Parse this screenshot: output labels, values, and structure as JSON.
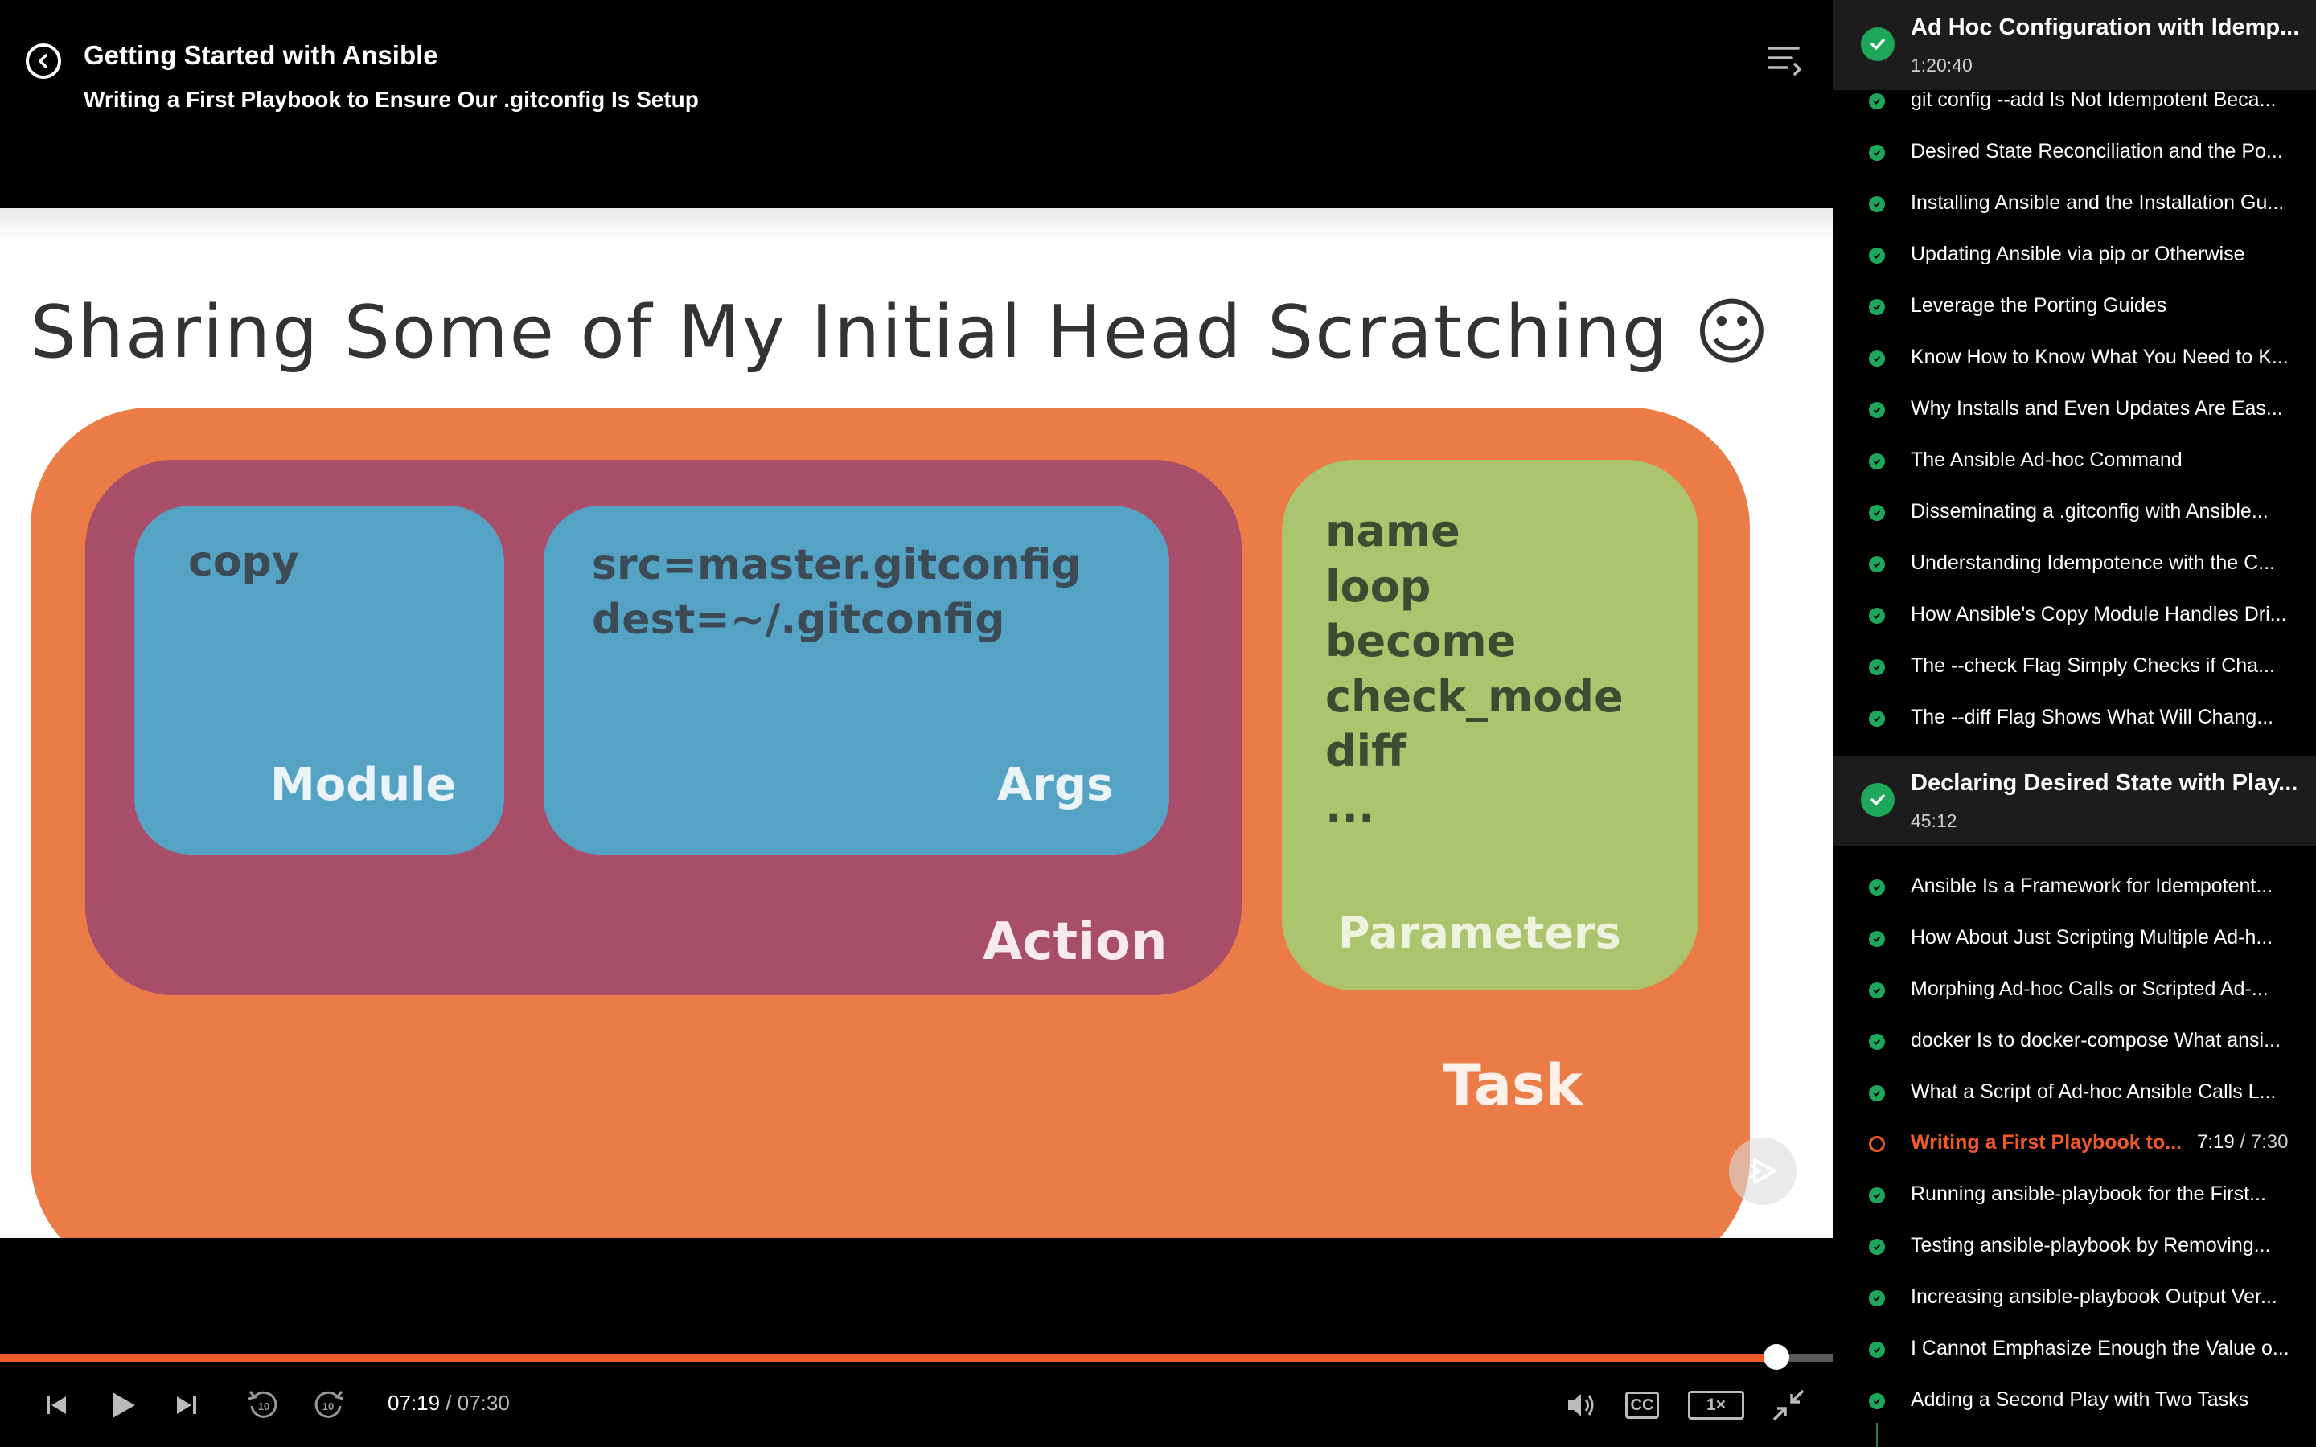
{
  "header": {
    "course_title": "Getting Started with Ansible",
    "clip_title": "Writing a First Playbook to Ensure Our .gitconfig Is Setup"
  },
  "slide": {
    "title": "Sharing Some of My Initial Head Scratching ☺",
    "module_content": "copy",
    "module_label": "Module",
    "args_content": "src=master.gitconfig\ndest=~/.gitconfig",
    "args_label": "Args",
    "action_label": "Action",
    "params_content": "name\nloop\nbecome\ncheck_mode\ndiff\n...",
    "params_label": "Parameters",
    "task_label": "Task"
  },
  "controls": {
    "time_current": "07:19",
    "time_separator": " / ",
    "time_total": "07:30",
    "progress_fraction": 0.9689,
    "cc_label": "CC",
    "speed_label": "1×",
    "accent_color": "#f05a28",
    "icons": [
      "previous-icon",
      "play-icon",
      "next-icon",
      "rewind-10-icon",
      "forward-10-icon",
      "volume-icon",
      "captions-icon",
      "speed-icon",
      "exit-fullscreen-icon"
    ]
  },
  "sidebar": {
    "module_1": {
      "title": "Ad Hoc Configuration with Idemp...",
      "duration": "1:20:40"
    },
    "module_1_clips": [
      "git config --add Is Not Idempotent Beca...",
      "Desired State Reconciliation and the Po...",
      "Installing Ansible and the Installation Gu...",
      "Updating Ansible via pip or Otherwise",
      "Leverage the Porting Guides",
      "Know How to Know What You Need to K...",
      "Why Installs and Even Updates Are Eas...",
      "The Ansible Ad-hoc Command",
      "Disseminating a .gitconfig with Ansible...",
      "Understanding Idempotence with the C...",
      "How Ansible's Copy Module Handles Dri...",
      "The --check Flag Simply Checks if Cha...",
      "The --diff Flag Shows What Will Chang..."
    ],
    "module_2": {
      "title": "Declaring Desired State with Play...",
      "duration": "45:12"
    },
    "module_2_clips_before": [
      "Ansible Is a Framework for Idempotent...",
      "How About Just Scripting Multiple Ad-h...",
      "Morphing Ad-hoc Calls or Scripted Ad-...",
      "docker Is to docker-compose What ansi...",
      "What a Script of Ad-hoc Ansible Calls L..."
    ],
    "active_clip": {
      "title": "Writing a First Playbook to...",
      "time_current": "7:19",
      "separator": " / ",
      "time_total": "7:30"
    },
    "module_2_clips_after": [
      "Running ansible-playbook for the First...",
      "Testing ansible-playbook by Removing...",
      "Increasing ansible-playbook Output Ver...",
      "I Cannot Emphasize Enough the Value o...",
      "Adding a Second Play with Two Tasks"
    ],
    "completed_color": "#1ea75a"
  }
}
